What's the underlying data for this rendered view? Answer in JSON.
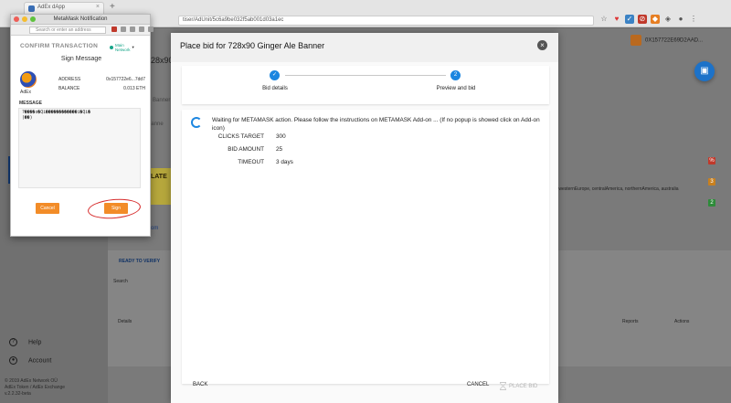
{
  "browser": {
    "tab_title": "AdEx dApp",
    "new_tab": "+",
    "url": "tiser/AdUnit/5c6a9be032f5ab001d03a1ec"
  },
  "app_bg": {
    "page_title": "728x90",
    "sub1": "e Banner",
    "sub2": "banne",
    "banner_text": "R LATE F.",
    "link": "com",
    "ready_tab": "READY TO VERIFY",
    "search_label": "Search",
    "col_details": "Details",
    "col_reports": "Reports",
    "col_actions": "Actions",
    "row_text": "pe, westernEurope, centralAmerica, northernAmerica, australia",
    "badges": [
      "%",
      "3",
      "2"
    ],
    "user_address": "0X157722E69D2AAD...",
    "sidebar_help": "Help",
    "sidebar_account": "Account",
    "footer": "© 2019 AdEx Network OÜ\nAdEx Token / AdEx Exchange\nv.2.2.32-beta"
  },
  "modal": {
    "title": "Place bid for 728x90 Ginger Ale Banner",
    "steps": [
      {
        "number": "✓",
        "label": "Bid details"
      },
      {
        "number": "2",
        "label": "Preview and bid"
      }
    ],
    "waiting_text": "Waiting for METAMASK action. Please follow the instructions on METAMASK Add-on ... (If no popup is showed click on Add-on icon)",
    "fields": [
      {
        "label": "CLICKS TARGET",
        "value": "300"
      },
      {
        "label": "BID AMOUNT",
        "value": "25"
      },
      {
        "label": "TIMEOUT",
        "value": "3 days"
      }
    ],
    "back_label": "BACK",
    "cancel_label": "CANCEL",
    "place_bid_label": "PLACE BID"
  },
  "metamask": {
    "window_title": "MetaMask Notification",
    "search_placeholder": "Search or enter an address",
    "confirm_label": "CONFIRM TRANSACTION",
    "network_label": "Main\nNetwork",
    "sign_message_title": "Sign Message",
    "account_name": "AdEx",
    "address_label": "ADDRESS",
    "address_value": "0x157722e6...7dd7",
    "balance_label": "BALANCE",
    "balance_value": "0.013 ETH",
    "message_label": "MESSAGE",
    "message_value": "?����o�Qi������������i�Qi�\n(��)",
    "cancel_label": "Cancel",
    "sign_label": "Sign"
  },
  "colors": {
    "accent_blue": "#1c86e0",
    "metamask_orange": "#f28c28",
    "annotation_red": "#d62b2b"
  }
}
